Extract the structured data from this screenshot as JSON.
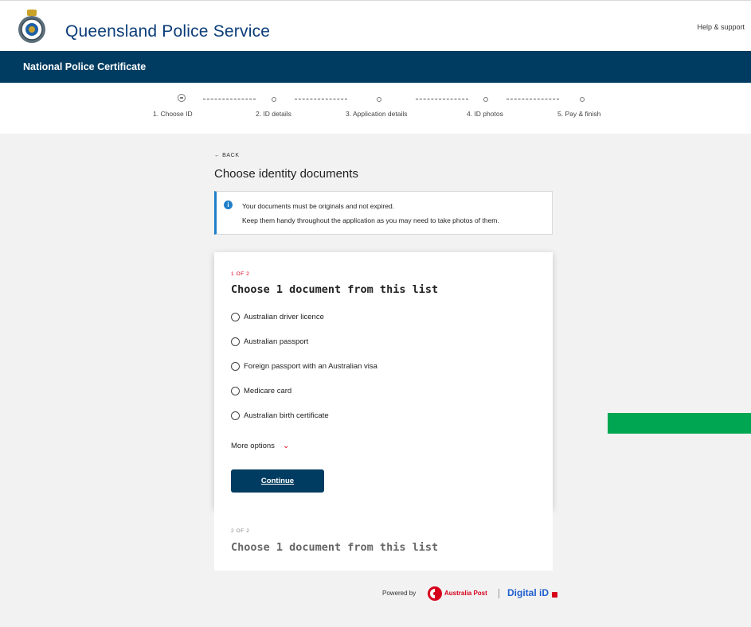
{
  "header": {
    "brand": "Queensland Police Service",
    "help_link": "Help & support"
  },
  "navbar": {
    "title": "National Police Certificate"
  },
  "stepper": {
    "steps": [
      {
        "label": "1. Choose ID",
        "state": "current"
      },
      {
        "label": "2. ID details",
        "state": "upcoming"
      },
      {
        "label": "3. Application details",
        "state": "upcoming"
      },
      {
        "label": "4. ID photos",
        "state": "upcoming"
      },
      {
        "label": "5. Pay & finish",
        "state": "upcoming"
      }
    ]
  },
  "page": {
    "back_label": "← BACK",
    "title": "Choose identity documents",
    "info_line1": "Your documents must be originals and not expired.",
    "info_line2": "Keep them handy throughout the application as you may need to take photos of them.",
    "info_icon": "i"
  },
  "list1": {
    "count": "1 OF 2",
    "title": "Choose 1 document from this list",
    "options": [
      "Australian driver licence",
      "Australian passport",
      "Foreign passport with an Australian visa",
      "Medicare card",
      "Australian birth certificate"
    ],
    "more_label": "More options",
    "more_chevron": "⌄",
    "continue_label": "Continue"
  },
  "list2": {
    "count": "2 OF 2",
    "title": "Choose 1 document from this list"
  },
  "footer": {
    "powered_by": "Powered by",
    "ap_name": "Australia Post",
    "digital_id": "Digital iD"
  },
  "colors": {
    "navy": "#003c61",
    "brand_blue": "#0a3c78",
    "accent_red": "#d6001c",
    "info_blue": "#1f7fc9",
    "green": "#00a651"
  }
}
